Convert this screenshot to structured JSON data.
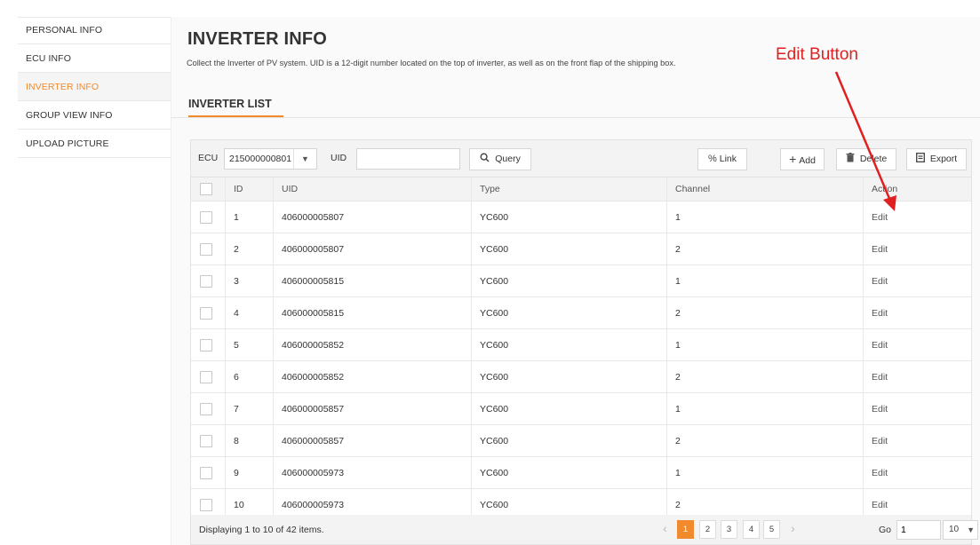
{
  "sidebar": {
    "items": [
      {
        "label": "PERSONAL INFO"
      },
      {
        "label": "ECU INFO"
      },
      {
        "label": "INVERTER INFO"
      },
      {
        "label": "GROUP VIEW INFO"
      },
      {
        "label": "UPLOAD PICTURE"
      }
    ],
    "active_index": 2
  },
  "header": {
    "title": "INVERTER INFO",
    "description": "Collect the Inverter of PV system. UID is a 12-digit number located on the top of inverter, as well as on the front flap of the shipping box.",
    "section_tab": "INVERTER LIST"
  },
  "toolbar": {
    "ecu_label": "ECU",
    "ecu_value": "215000000801",
    "uid_label": "UID",
    "uid_value": "",
    "query_label": "Query",
    "link_label": "Link",
    "add_label": "Add",
    "delete_label": "Delete",
    "export_label": "Export"
  },
  "table": {
    "columns": [
      "ID",
      "UID",
      "Type",
      "Channel",
      "Action"
    ],
    "rows": [
      {
        "id": "1",
        "uid": "406000005807",
        "type": "YC600",
        "channel": "1",
        "action": "Edit"
      },
      {
        "id": "2",
        "uid": "406000005807",
        "type": "YC600",
        "channel": "2",
        "action": "Edit"
      },
      {
        "id": "3",
        "uid": "406000005815",
        "type": "YC600",
        "channel": "1",
        "action": "Edit"
      },
      {
        "id": "4",
        "uid": "406000005815",
        "type": "YC600",
        "channel": "2",
        "action": "Edit"
      },
      {
        "id": "5",
        "uid": "406000005852",
        "type": "YC600",
        "channel": "1",
        "action": "Edit"
      },
      {
        "id": "6",
        "uid": "406000005852",
        "type": "YC600",
        "channel": "2",
        "action": "Edit"
      },
      {
        "id": "7",
        "uid": "406000005857",
        "type": "YC600",
        "channel": "1",
        "action": "Edit"
      },
      {
        "id": "8",
        "uid": "406000005857",
        "type": "YC600",
        "channel": "2",
        "action": "Edit"
      },
      {
        "id": "9",
        "uid": "406000005973",
        "type": "YC600",
        "channel": "1",
        "action": "Edit"
      },
      {
        "id": "10",
        "uid": "406000005973",
        "type": "YC600",
        "channel": "2",
        "action": "Edit"
      }
    ]
  },
  "pagination": {
    "summary": "Displaying 1 to 10 of 42 items.",
    "pages": [
      "1",
      "2",
      "3",
      "4",
      "5"
    ],
    "current_page": "1",
    "go_label": "Go",
    "go_value": "1",
    "page_size": "10"
  },
  "annotation": {
    "label": "Edit Button"
  },
  "colors": {
    "accent": "#f08a2c",
    "annotation": "#e02020"
  }
}
